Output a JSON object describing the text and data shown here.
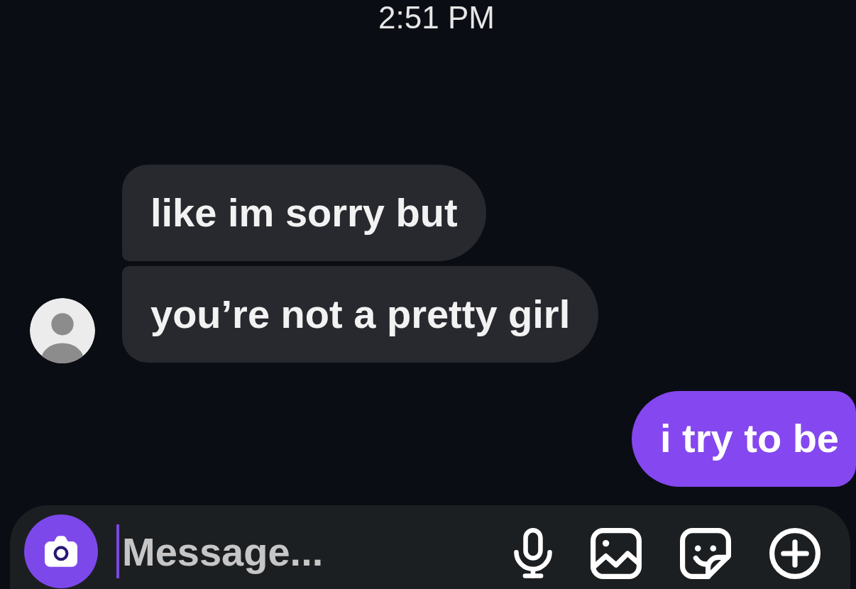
{
  "timestamp": "2:51 PM",
  "messages": [
    {
      "kind": "received",
      "text": "like im sorry but"
    },
    {
      "kind": "received",
      "text": "you’re not a pretty girl"
    },
    {
      "kind": "sent",
      "text": "i try to be"
    }
  ],
  "composer": {
    "placeholder": "Message..."
  }
}
